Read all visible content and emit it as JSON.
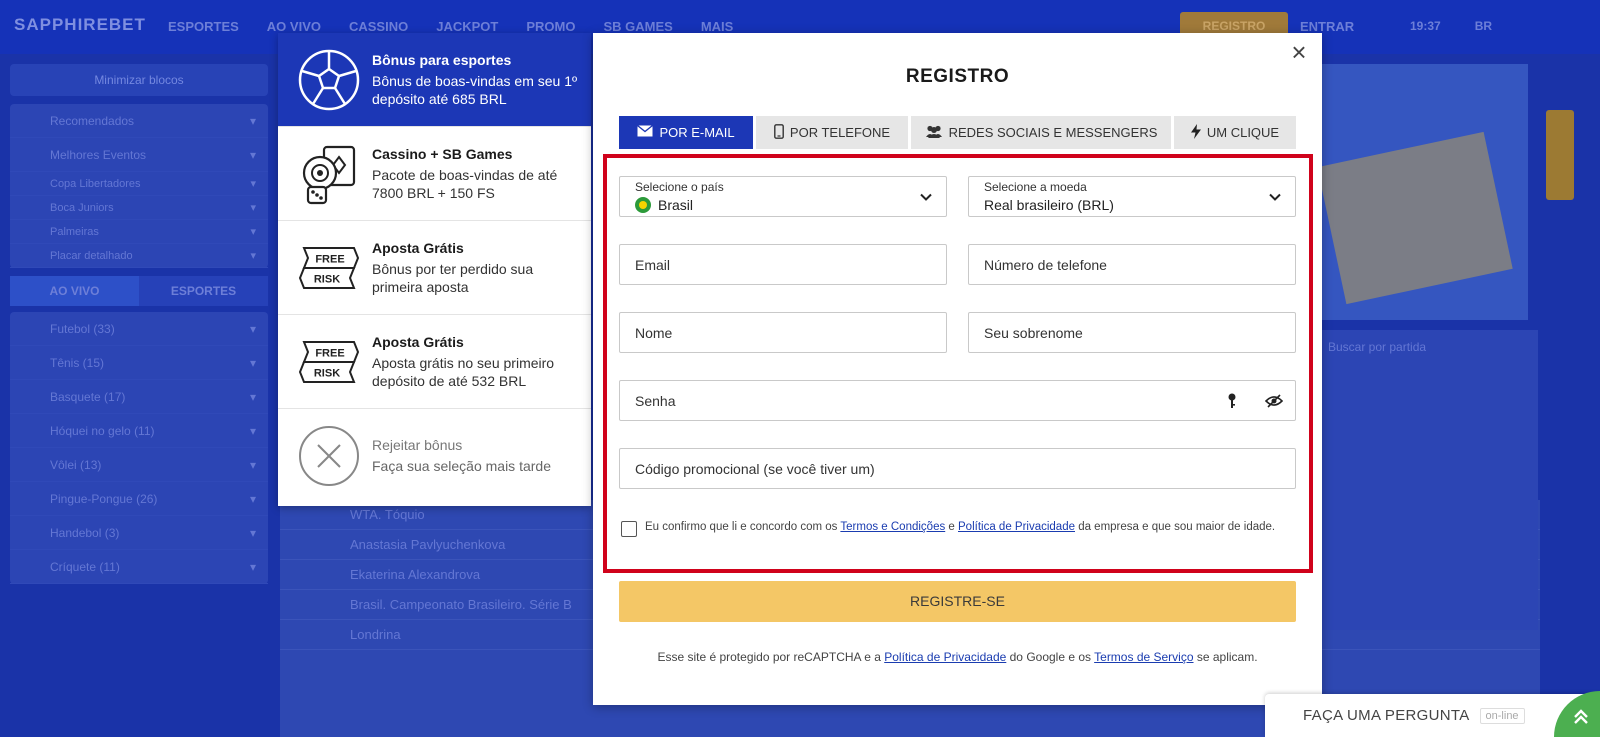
{
  "background": {
    "logo": "SAPPHIREBET",
    "nav": [
      "ESPORTES",
      "AO VIVO",
      "CASSINO",
      "JACKPOT",
      "PROMO",
      "SB GAMES",
      "MAIS"
    ],
    "register": "REGISTRO",
    "login": "ENTRAR",
    "right": [
      "19:37",
      "BR"
    ],
    "sidebar_header": "Minimizar blocos",
    "sidebar_top": [
      "Recomendados",
      "Melhores Eventos"
    ],
    "sidebar_match": [
      "Copa Libertadores",
      "Boca Juniors",
      "Palmeiras",
      "Placar detalhado"
    ],
    "live_tabs": [
      "AO VIVO",
      "ESPORTES"
    ],
    "sports": [
      "Futebol (33)",
      "Tênis (15)",
      "Basquete (17)",
      "Hóquei no gelo (11)",
      "Vôlei (13)",
      "Pingue-Pongue (26)",
      "Handebol (3)",
      "Críquete (11)"
    ],
    "center_rows": [
      "WTA. Tóquio",
      "Anastasia Pavlyuchenkova",
      "Ekaterina Alexandrova",
      "Brasil. Campeonato Brasileiro. Série B",
      "Londrina"
    ],
    "search": "Buscar por partida"
  },
  "bonuses": [
    {
      "title": "Bônus para esportes",
      "desc": "Bônus de boas-vindas em seu 1º depósito até 685 BRL",
      "icon": "soccer-ball-icon",
      "active": true
    },
    {
      "title": "Cassino + SB Games",
      "desc": "Pacote de boas-vindas de até 7800 BRL + 150 FS",
      "icon": "casino-chips-icon",
      "active": false
    },
    {
      "title": "Aposta Grátis",
      "desc": "Bônus por ter perdido sua primeira aposta",
      "icon": "free-risk-icon",
      "active": false
    },
    {
      "title": "Aposta Grátis",
      "desc": "Aposta grátis no seu primeiro depósito de até 532 BRL",
      "icon": "free-risk-icon",
      "active": false
    },
    {
      "title": "Rejeitar bônus",
      "desc": "Faça sua seleção mais tarde",
      "icon": "close-circle-icon",
      "active": false
    }
  ],
  "free_risk": {
    "free": "FREE",
    "risk": "RISK"
  },
  "modal": {
    "title": "REGISTRO",
    "close": "×",
    "tabs": [
      {
        "label": "POR E-MAIL",
        "icon": "email-icon",
        "active": true
      },
      {
        "label": "POR TELEFONE",
        "icon": "phone-icon",
        "active": false
      },
      {
        "label": "REDES SOCIAIS E MESSENGERS",
        "icon": "people-icon",
        "active": false
      },
      {
        "label": "UM CLIQUE",
        "icon": "lightning-icon",
        "active": false
      }
    ],
    "country": {
      "label": "Selecione o país",
      "value": "Brasil"
    },
    "currency": {
      "label": "Selecione a moeda",
      "value": "Real brasileiro (BRL)"
    },
    "email_placeholder": "Email",
    "phone_placeholder": "Número de telefone",
    "name_placeholder": "Nome",
    "surname_placeholder": "Seu sobrenome",
    "password_placeholder": "Senha",
    "promo_placeholder": "Código promocional (se você tiver um)",
    "terms": {
      "pre": "Eu confirmo que li e concordo com os ",
      "link1": "Termos e Condições",
      "mid": " e ",
      "link2": "Política de Privacidade",
      "post": " da empresa e que sou maior de idade."
    },
    "submit": "REGISTRE-SE",
    "recaptcha": {
      "pre": "Esse site é protegido por reCAPTCHA e a ",
      "link1": "Política de Privacidade",
      "mid": " do Google e os ",
      "link2": "Termos de Serviço",
      "post": " se aplicam."
    }
  },
  "chat": {
    "label": "FAÇA UMA PERGUNTA",
    "status": "on-line"
  },
  "colors": {
    "brand_blue": "#1c37b6",
    "submit_yellow": "#f4c766",
    "frame_red": "#d0021b",
    "chat_green": "#4caf50"
  }
}
